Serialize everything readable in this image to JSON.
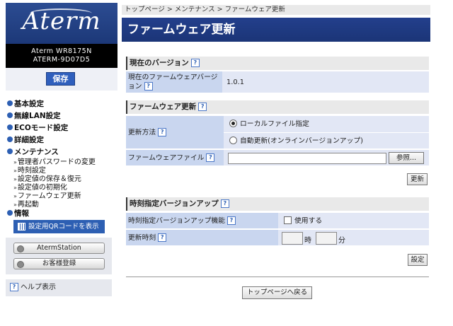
{
  "sidebar": {
    "logo_text": "Aterm",
    "model_line1": "Aterm WR8175N",
    "model_line2": "ATERM-9D07D5",
    "save_label": "保存",
    "menu": {
      "basic": "基本設定",
      "wlan": "無線LAN設定",
      "eco": "ECOモード設定",
      "detail": "詳細設定",
      "maintenance": "メンテナンス",
      "info": "情報"
    },
    "maintenance_items": [
      "管理者パスワードの変更",
      "時刻設定",
      "設定値の保存＆復元",
      "設定値の初期化",
      "ファームウェア更新",
      "再起動"
    ],
    "qr_label": "設定用QRコードを表示",
    "atermstation_label": "AtermStation",
    "register_label": "お客様登録",
    "help_label": "ヘルプ表示"
  },
  "breadcrumb": "トップページ > メンテナンス > ファームウェア更新",
  "page_title": "ファームウェア更新",
  "help_glyph": "?",
  "current_version": {
    "header": "現在のバージョン",
    "label": "現在のファームウェアバージョン",
    "value": "1.0.1"
  },
  "firmware_update": {
    "header": "ファームウェア更新",
    "method_label": "更新方法",
    "option_local": "ローカルファイル指定",
    "option_auto": "自動更新(オンラインバージョンアップ)",
    "selected_option": "local",
    "file_label": "ファームウェアファイル",
    "file_value": "",
    "browse_label": "参照...",
    "update_label": "更新"
  },
  "scheduled_update": {
    "header": "時刻指定バージョンアップ",
    "feature_label": "時刻指定バージョンアップ機能",
    "use_label": "使用する",
    "use_checked": false,
    "time_label": "更新時刻",
    "hour_value": "",
    "hour_unit": "時",
    "minute_value": "",
    "minute_unit": "分",
    "set_label": "設定"
  },
  "back_label": "トップページへ戻る"
}
